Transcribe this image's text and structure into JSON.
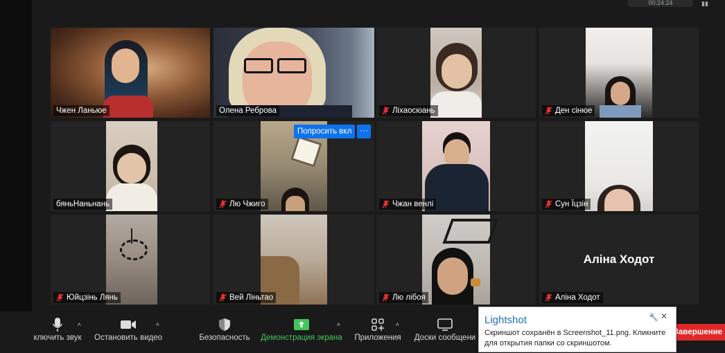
{
  "top": {
    "timer_text": "00:24:24"
  },
  "participants": [
    {
      "name": "Чжен Ланьюе",
      "muted": false,
      "active": true,
      "video": true
    },
    {
      "name": "Олена Реброва",
      "muted": false,
      "active": false,
      "video": true
    },
    {
      "name": "Ліхаосюань",
      "muted": true,
      "active": false,
      "video": true
    },
    {
      "name": "Ден сінюе",
      "muted": true,
      "active": false,
      "video": true
    },
    {
      "name": "бяньНаньнань",
      "muted": false,
      "active": false,
      "video": true
    },
    {
      "name": "Лю Чжиго",
      "muted": true,
      "active": false,
      "video": true
    },
    {
      "name": "Чжан венлі",
      "muted": true,
      "active": false,
      "video": true
    },
    {
      "name": "Сун Їцзін",
      "muted": true,
      "active": false,
      "video": true
    },
    {
      "name": "Юйцзінь Лянь",
      "muted": true,
      "active": false,
      "video": true
    },
    {
      "name": "Вей Ліньтао",
      "muted": true,
      "active": false,
      "video": true
    },
    {
      "name": "Лю  лібоя",
      "muted": true,
      "active": false,
      "video": true
    },
    {
      "name": "Аліна Ходот",
      "muted": true,
      "active": false,
      "video": false,
      "big_name": "Аліна Ходот"
    }
  ],
  "overlay": {
    "ask_unmute_label": "Попросить вкл",
    "more_label": "···"
  },
  "toolbar": {
    "mute_label": "ключить звук",
    "video_label": "Остановить видео",
    "security_label": "Безопасность",
    "share_label": "Демонстрация экрана",
    "apps_label": "Приложения",
    "whiteboard_label": "Доски сообщени",
    "end_label": "Завершение"
  },
  "notification": {
    "title": "Lightshot",
    "message": "Скриншот сохранён в Screenshot_11.png. Кликните для открытия папки со скриншотом."
  },
  "colors": {
    "active_border": "#d6e27a",
    "share_green": "#43c55d",
    "end_red": "#e02828",
    "accent_blue": "#0e72ed",
    "muted_red": "#e33"
  }
}
